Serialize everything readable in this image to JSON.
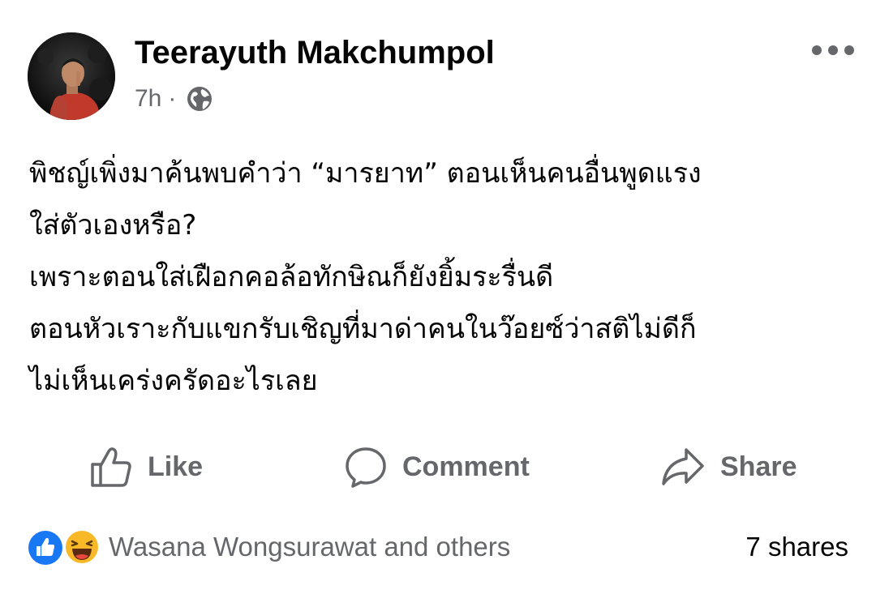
{
  "post": {
    "author": "Teerayuth Makchumpol",
    "time": "7h",
    "separator": "·",
    "privacy_icon": "globe-icon",
    "menu_icon": "more-horizontal-icon",
    "content_lines": [
      "พิชญ์เพิ่งมาค้นพบคำว่า “มารยาท” ตอนเห็นคนอื่นพูดแรง",
      "ใส่ตัวเองหรือ?",
      "เพราะตอนใส่เฝือกคอล้อทักษิณก็ยังยิ้มระรื่นดี",
      "ตอนหัวเราะกับแขกรับเชิญที่มาด่าคนในว๊อยซ์ว่าสติไม่ดีก็",
      "ไม่เห็นเคร่งครัดอะไรเลย"
    ]
  },
  "actions": {
    "like_label": "Like",
    "comment_label": "Comment",
    "share_label": "Share"
  },
  "reactions": {
    "icons": [
      "like-reaction-icon",
      "haha-reaction-icon"
    ],
    "summary": "Wasana Wongsurawat and others",
    "shares": "7 shares"
  },
  "colors": {
    "text_primary": "#050505",
    "text_secondary": "#65676b",
    "like_blue": "#1877f2",
    "haha_yellow": "#f7b928"
  }
}
